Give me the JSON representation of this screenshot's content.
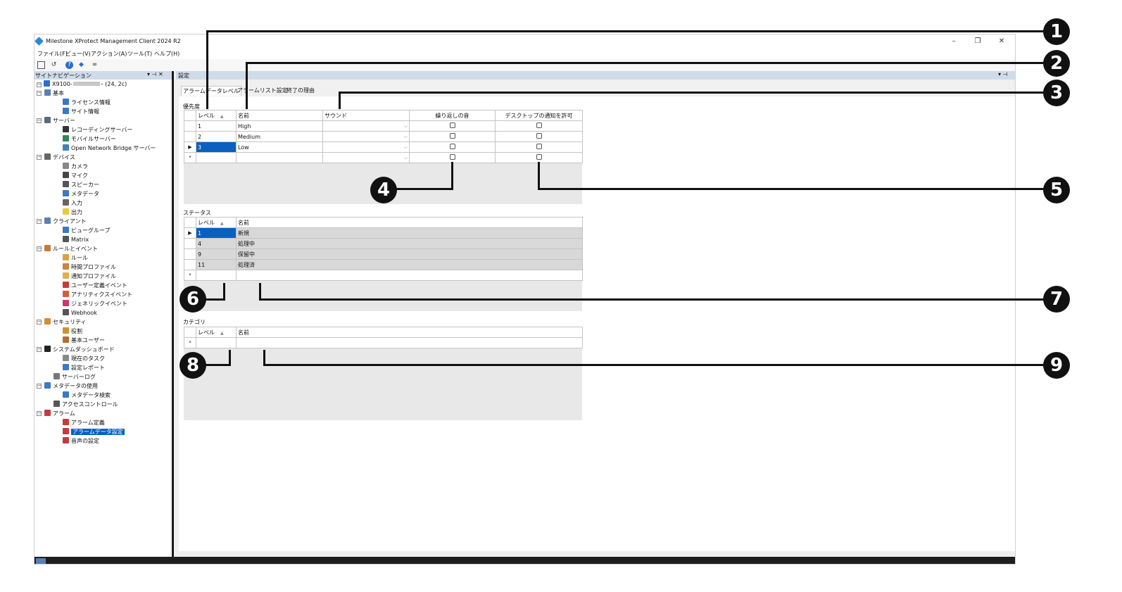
{
  "window": {
    "title": "Milestone XProtect Management Client 2024 R2",
    "controls": [
      "–",
      "❐",
      "✕"
    ]
  },
  "menu": [
    "ファイル(F)",
    "ビュー(V)",
    "アクション(A)",
    "ツール(T)",
    "ヘルプ(H)"
  ],
  "toolbar": {
    "icons": [
      "save-icon",
      "undo-icon",
      "help-icon",
      "connect-icon",
      "binoculars-icon"
    ]
  },
  "sidebar": {
    "title": "サイトナビゲーション",
    "controls": "▾ ⊣ ✕",
    "server_prefix": "X9100-",
    "server_suffix": "– (24, 2c)",
    "items": [
      {
        "label": "基本",
        "icon_color": "#5a7fb5"
      },
      {
        "label": "ライセンス情報",
        "icon_color": "#3a78c8"
      },
      {
        "label": "サイト情報",
        "icon_color": "#3a78c8"
      },
      {
        "label": "サーバー",
        "icon_color": "#5a6b80"
      },
      {
        "label": "レコーディングサーバー",
        "icon_color": "#333"
      },
      {
        "label": "モバイルサーバー",
        "icon_color": "#2e8b57"
      },
      {
        "label": "Open Network Bridge サーバー",
        "icon_color": "#4682b4"
      },
      {
        "label": "デバイス",
        "icon_color": "#666"
      },
      {
        "label": "カメラ",
        "icon_color": "#888"
      },
      {
        "label": "マイク",
        "icon_color": "#444"
      },
      {
        "label": "スピーカー",
        "icon_color": "#555"
      },
      {
        "label": "メタデータ",
        "icon_color": "#3a78c8"
      },
      {
        "label": "入力",
        "icon_color": "#666"
      },
      {
        "label": "出力",
        "icon_color": "#e8c93a"
      },
      {
        "label": "クライアント",
        "icon_color": "#5a7fb5"
      },
      {
        "label": "ビューグループ",
        "icon_color": "#3a78c8"
      },
      {
        "label": "Matrix",
        "icon_color": "#555"
      },
      {
        "label": "ルールとイベント",
        "icon_color": "#c87a3a"
      },
      {
        "label": "ルール",
        "icon_color": "#e0a040"
      },
      {
        "label": "時間プロファイル",
        "icon_color": "#d08040"
      },
      {
        "label": "通知プロファイル",
        "icon_color": "#e0b050"
      },
      {
        "label": "ユーザー定義イベント",
        "icon_color": "#c83a3a"
      },
      {
        "label": "アナリティクスイベント",
        "icon_color": "#d0603a"
      },
      {
        "label": "ジェネリックイベント",
        "icon_color": "#c83a6a"
      },
      {
        "label": "Webhook",
        "icon_color": "#555"
      },
      {
        "label": "セキュリティ",
        "icon_color": "#d09030"
      },
      {
        "label": "役割",
        "icon_color": "#d09030"
      },
      {
        "label": "基本ユーザー",
        "icon_color": "#b07030"
      },
      {
        "label": "システムダッシュボード",
        "icon_color": "#222"
      },
      {
        "label": "現在のタスク",
        "icon_color": "#888"
      },
      {
        "label": "設定レポート",
        "icon_color": "#3a78c8"
      },
      {
        "label": "サーバーログ",
        "icon_color": "#777"
      },
      {
        "label": "メタデータの使用",
        "icon_color": "#3a78c8"
      },
      {
        "label": "メタデータ検索",
        "icon_color": "#3a78c8"
      },
      {
        "label": "アクセスコントロール",
        "icon_color": "#555"
      },
      {
        "label": "アラーム",
        "icon_color": "#c83a3a"
      },
      {
        "label": "アラーム定義",
        "icon_color": "#c83a3a"
      },
      {
        "label": "アラームデータ設定",
        "icon_color": "#c83a3a"
      },
      {
        "label": "音声の設定",
        "icon_color": "#c83a3a"
      }
    ]
  },
  "content": {
    "header_title": "設定",
    "header_controls": "▾ ⊣",
    "tabs": [
      "アラームデータレベル",
      "アラームリスト設定",
      "終了の理由"
    ]
  },
  "priority": {
    "label": "優先度",
    "columns": [
      "レベル",
      "名前",
      "サウンド",
      "繰り返しの音",
      "デスクトップの通知を許可"
    ],
    "rows": [
      {
        "level": "1",
        "name": "High"
      },
      {
        "level": "2",
        "name": "Medium"
      },
      {
        "level": "3",
        "name": "Low"
      }
    ],
    "current_marker": "▶",
    "new_marker": "*"
  },
  "status": {
    "label": "ステータス",
    "columns": [
      "レベル",
      "名前"
    ],
    "rows": [
      {
        "level": "1",
        "name": "新規"
      },
      {
        "level": "4",
        "name": "処理中"
      },
      {
        "level": "9",
        "name": "保留中"
      },
      {
        "level": "11",
        "name": "処理済"
      }
    ]
  },
  "category": {
    "label": "カテゴリ",
    "columns": [
      "レベル",
      "名前"
    ]
  },
  "callouts": [
    "1",
    "2",
    "3",
    "4",
    "5",
    "6",
    "7",
    "8",
    "9"
  ]
}
